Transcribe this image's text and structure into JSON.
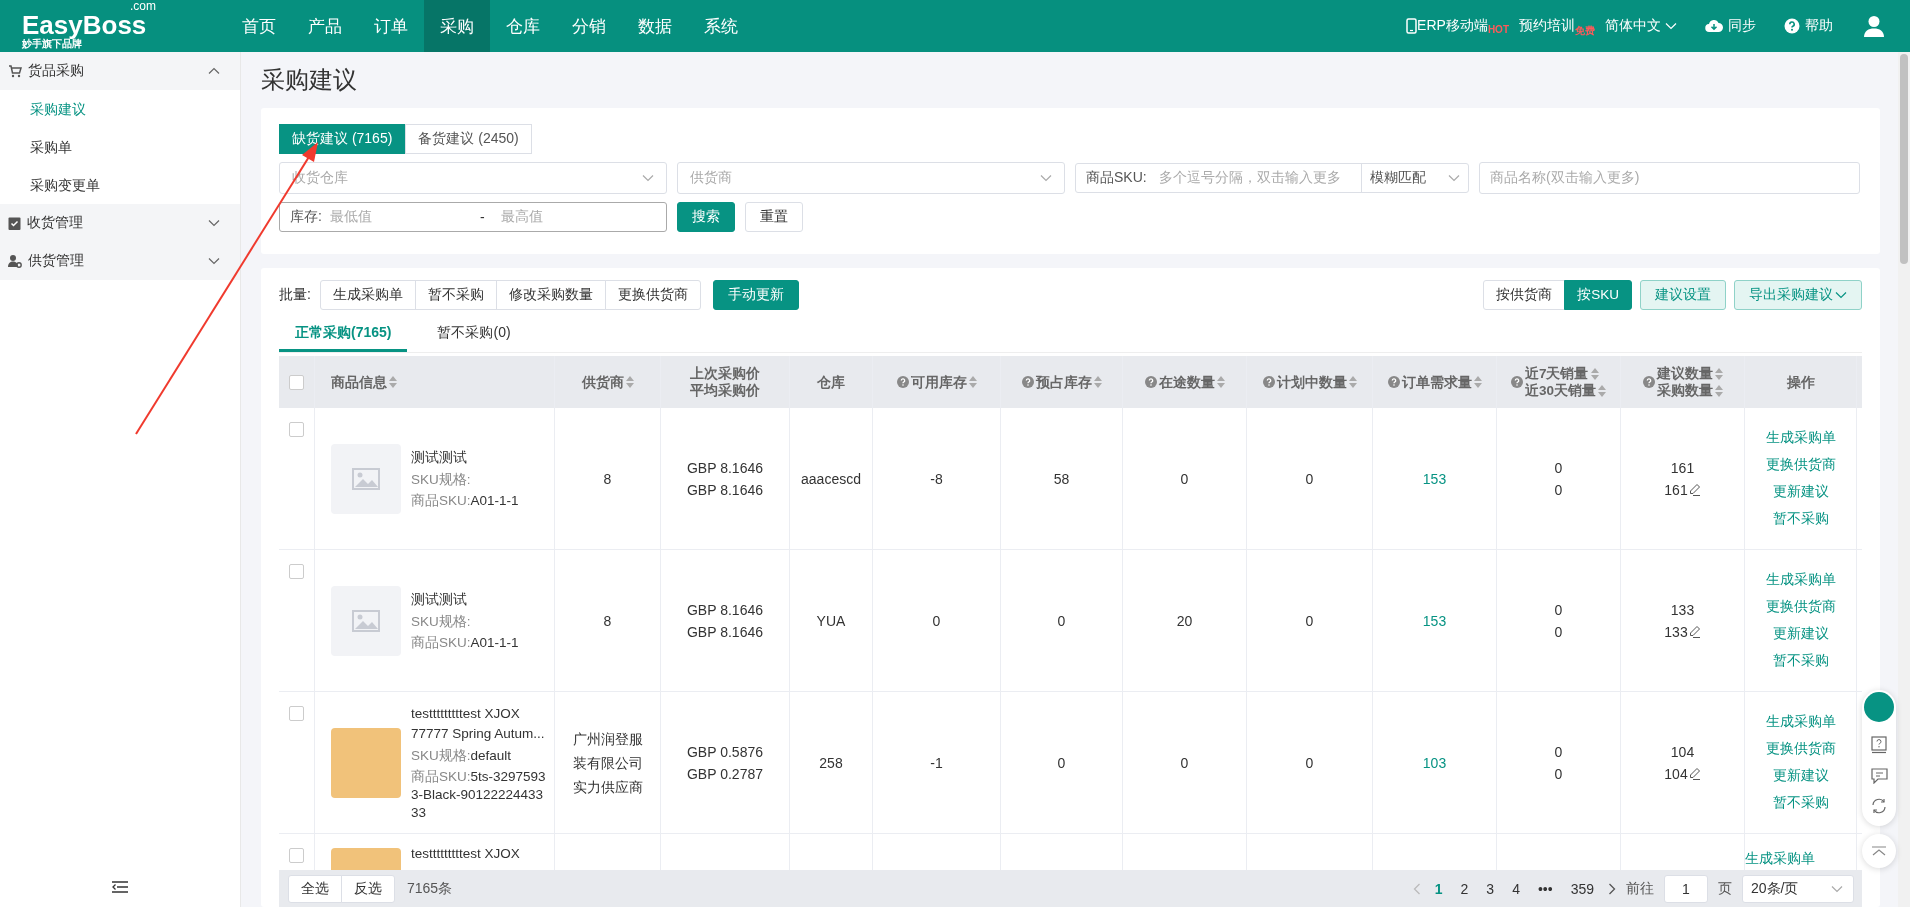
{
  "header": {
    "logo": {
      "name": "EasyBoss",
      "domain": ".com",
      "tagline": "妙手旗下品牌"
    },
    "nav": [
      {
        "label": "首页",
        "selected": false
      },
      {
        "label": "产品",
        "selected": false
      },
      {
        "label": "订单",
        "selected": false
      },
      {
        "label": "采购",
        "selected": true
      },
      {
        "label": "仓库",
        "selected": false
      },
      {
        "label": "分销",
        "selected": false
      },
      {
        "label": "数据",
        "selected": false
      },
      {
        "label": "系统",
        "selected": false
      }
    ],
    "mobile": {
      "label": "ERP移动端",
      "badge": "HOT"
    },
    "training": {
      "label": "预约培训",
      "badge": "免费"
    },
    "language": "简体中文",
    "sync": "同步",
    "help": "帮助"
  },
  "sidebar": {
    "groups": [
      {
        "label": "货品采购",
        "expanded": true,
        "children": [
          {
            "label": "采购建议",
            "selected": true
          },
          {
            "label": "采购单",
            "selected": false
          },
          {
            "label": "采购变更单",
            "selected": false
          }
        ]
      },
      {
        "label": "收货管理",
        "expanded": false
      },
      {
        "label": "供货管理",
        "expanded": false
      }
    ]
  },
  "page_title": "采购建议",
  "filter": {
    "tabs": [
      {
        "label": "缺货建议 (7165)",
        "selected": true
      },
      {
        "label": "备货建议 (2450)",
        "selected": false
      }
    ],
    "warehouse": {
      "placeholder": "收货仓库"
    },
    "supplier": {
      "placeholder": "供货商"
    },
    "sku": {
      "label": "商品SKU:",
      "placeholder": "多个逗号分隔，双击输入更多",
      "match": "模糊匹配"
    },
    "product_name": {
      "placeholder": "商品名称(双击输入更多)"
    },
    "stock": {
      "label": "库存:",
      "min_placeholder": "最低值",
      "separator": "-",
      "max_placeholder": "最高值"
    },
    "search": "搜索",
    "reset": "重置"
  },
  "toolbar": {
    "batch_label": "批量:",
    "batch_buttons": [
      "生成采购单",
      "暂不采购",
      "修改采购数量",
      "更换供货商"
    ],
    "manual_update": "手动更新",
    "view_toggle": [
      {
        "label": "按供货商",
        "selected": false
      },
      {
        "label": "按SKU",
        "selected": true
      }
    ],
    "settings": "建议设置",
    "export": "导出采购建议"
  },
  "subtabs": [
    {
      "label": "正常采购(7165)",
      "selected": true
    },
    {
      "label": "暂不采购(0)",
      "selected": false
    }
  ],
  "table": {
    "header_checked": false,
    "columns": [
      {
        "lines": [
          "商品信息"
        ],
        "help": false,
        "sortable": true
      },
      {
        "lines": [
          "供货商"
        ],
        "help": false,
        "sortable": true
      },
      {
        "lines": [
          "上次采购价",
          "平均采购价"
        ],
        "help": false,
        "sortable": false
      },
      {
        "lines": [
          "仓库"
        ],
        "help": false,
        "sortable": false
      },
      {
        "lines": [
          "可用库存"
        ],
        "help": true,
        "sortable": true
      },
      {
        "lines": [
          "预占库存"
        ],
        "help": true,
        "sortable": true
      },
      {
        "lines": [
          "在途数量"
        ],
        "help": true,
        "sortable": true
      },
      {
        "lines": [
          "计划中数量"
        ],
        "help": true,
        "sortable": true
      },
      {
        "lines": [
          "订单需求量"
        ],
        "help": true,
        "sortable": true
      },
      {
        "lines": [
          "近7天销量",
          "近30天销量"
        ],
        "help": true,
        "sortable": true
      },
      {
        "lines": [
          "建议数量",
          "采购数量"
        ],
        "help": true,
        "sortable": true
      },
      {
        "lines": [
          "操作"
        ],
        "help": false,
        "sortable": false
      }
    ],
    "rows": [
      {
        "checked": false,
        "kind": "placeholder",
        "name": "测试测试",
        "spec_label": "SKU规格:",
        "sku_label": "商品SKU:",
        "sku_value": "A01-1-1",
        "supplier": "8",
        "prices": [
          "GBP 8.1646",
          "GBP 8.1646"
        ],
        "warehouse": "aaacescd",
        "available": "-8",
        "reserved": "58",
        "in_transit": "0",
        "planned": "0",
        "demand": "153",
        "sales": [
          "0",
          "0"
        ],
        "suggested": "161",
        "purchase": "161",
        "actions": [
          "生成采购单",
          "更换供货商",
          "更新建议",
          "暂不采购"
        ]
      },
      {
        "checked": false,
        "kind": "placeholder",
        "name": "测试测试",
        "spec_label": "SKU规格:",
        "sku_label": "商品SKU:",
        "sku_value": "A01-1-1",
        "supplier": "8",
        "prices": [
          "GBP 8.1646",
          "GBP 8.1646"
        ],
        "warehouse": "YUA",
        "available": "0",
        "reserved": "0",
        "in_transit": "20",
        "planned": "0",
        "demand": "153",
        "sales": [
          "0",
          "0"
        ],
        "suggested": "133",
        "purchase": "133",
        "actions": [
          "生成采购单",
          "更换供货商",
          "更新建议",
          "暂不采购"
        ]
      },
      {
        "checked": false,
        "kind": "photo",
        "name": "testttttttttest XJOX 77777 Spring Autum...",
        "spec_label": "SKU规格:",
        "spec_value": "default",
        "sku_label": "商品SKU:",
        "sku_value": "5ts-32975933-Black-9012222443333",
        "supplier": "广州润登服装有限公司实力供应商",
        "prices": [
          "GBP 0.5876",
          "GBP 0.2787"
        ],
        "warehouse": "258",
        "available": "-1",
        "reserved": "0",
        "in_transit": "0",
        "planned": "0",
        "demand": "103",
        "sales": [
          "0",
          "0"
        ],
        "suggested": "104",
        "purchase": "104",
        "actions": [
          "生成采购单",
          "更换供货商",
          "更新建议",
          "暂不采购"
        ]
      },
      {
        "checked": false,
        "kind": "photo",
        "name": "testttttttttest XJOX",
        "actions": [
          "生成采购单"
        ]
      }
    ]
  },
  "footer": {
    "select_all": "全选",
    "invert": "反选",
    "total": "7165条",
    "pages": [
      {
        "label": "1",
        "selected": true
      },
      {
        "label": "2",
        "selected": false
      },
      {
        "label": "3",
        "selected": false
      },
      {
        "label": "4",
        "selected": false
      }
    ],
    "ellipsis": "•••",
    "last_page": "359",
    "goto_label": "前往",
    "goto_value": "1",
    "page_unit": "页",
    "page_size": "20条/页"
  }
}
